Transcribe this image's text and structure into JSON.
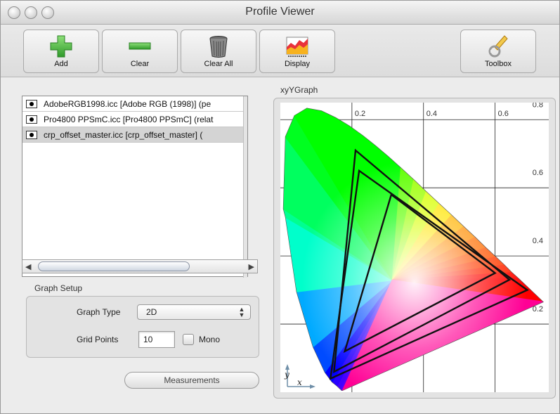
{
  "window": {
    "title": "Profile Viewer"
  },
  "toolbar": {
    "add_label": "Add",
    "clear_label": "Clear",
    "clear_all_label": "Clear All",
    "display_label": "Display",
    "toolbox_label": "Toolbox"
  },
  "profiles": {
    "items": [
      {
        "label": "AdobeRGB1998.icc [Adobe RGB (1998)] (pe",
        "selected": false
      },
      {
        "label": "Pro4800 PPSmC.icc [Pro4800 PPSmC] (relat",
        "selected": false
      },
      {
        "label": "crp_offset_master.icc [crp_offset_master] (",
        "selected": true
      }
    ]
  },
  "graph_setup": {
    "title": "Graph Setup",
    "graph_type_label": "Graph Type",
    "graph_type_value": "2D",
    "grid_points_label": "Grid Points",
    "grid_points_value": "10",
    "mono_label": "Mono",
    "mono_checked": false
  },
  "measurements_label": "Measurements",
  "graph": {
    "title": "xyYGraph",
    "x_tick_labels": [
      "0.2",
      "0.4",
      "0.6"
    ],
    "y_tick_labels": [
      "0.8",
      "0.6",
      "0.4",
      "0.2"
    ],
    "x_axis_letter": "x",
    "y_axis_letter": "y"
  },
  "chart_data": {
    "type": "scatter",
    "title": "xyYGraph",
    "xlabel": "x",
    "ylabel": "y",
    "xlim": [
      0.0,
      0.75
    ],
    "ylim": [
      0.0,
      0.85
    ],
    "x_ticks": [
      0.2,
      0.4,
      0.6
    ],
    "y_ticks": [
      0.2,
      0.4,
      0.6,
      0.8
    ],
    "grid": true,
    "spectral_locus": [
      [
        0.174,
        0.005
      ],
      [
        0.171,
        0.005
      ],
      [
        0.167,
        0.009
      ],
      [
        0.158,
        0.018
      ],
      [
        0.144,
        0.03
      ],
      [
        0.124,
        0.058
      ],
      [
        0.091,
        0.133
      ],
      [
        0.045,
        0.295
      ],
      [
        0.014,
        0.514
      ],
      [
        0.008,
        0.538
      ],
      [
        0.014,
        0.75
      ],
      [
        0.039,
        0.812
      ],
      [
        0.074,
        0.834
      ],
      [
        0.115,
        0.826
      ],
      [
        0.155,
        0.806
      ],
      [
        0.193,
        0.782
      ],
      [
        0.23,
        0.754
      ],
      [
        0.266,
        0.724
      ],
      [
        0.302,
        0.692
      ],
      [
        0.337,
        0.659
      ],
      [
        0.373,
        0.624
      ],
      [
        0.408,
        0.589
      ],
      [
        0.444,
        0.554
      ],
      [
        0.479,
        0.52
      ],
      [
        0.513,
        0.486
      ],
      [
        0.545,
        0.455
      ],
      [
        0.575,
        0.424
      ],
      [
        0.603,
        0.397
      ],
      [
        0.627,
        0.373
      ],
      [
        0.648,
        0.351
      ],
      [
        0.666,
        0.334
      ],
      [
        0.68,
        0.32
      ],
      [
        0.692,
        0.308
      ],
      [
        0.735,
        0.265
      ]
    ],
    "series": [
      {
        "values": [
          [
            0.64,
            0.33
          ],
          [
            0.21,
            0.71
          ],
          [
            0.15,
            0.06
          ]
        ]
      },
      {
        "values": [
          [
            0.69,
            0.3
          ],
          [
            0.22,
            0.65
          ],
          [
            0.14,
            0.04
          ]
        ]
      },
      {
        "values": [
          [
            0.6,
            0.35
          ],
          [
            0.31,
            0.58
          ],
          [
            0.18,
            0.12
          ]
        ]
      }
    ]
  }
}
